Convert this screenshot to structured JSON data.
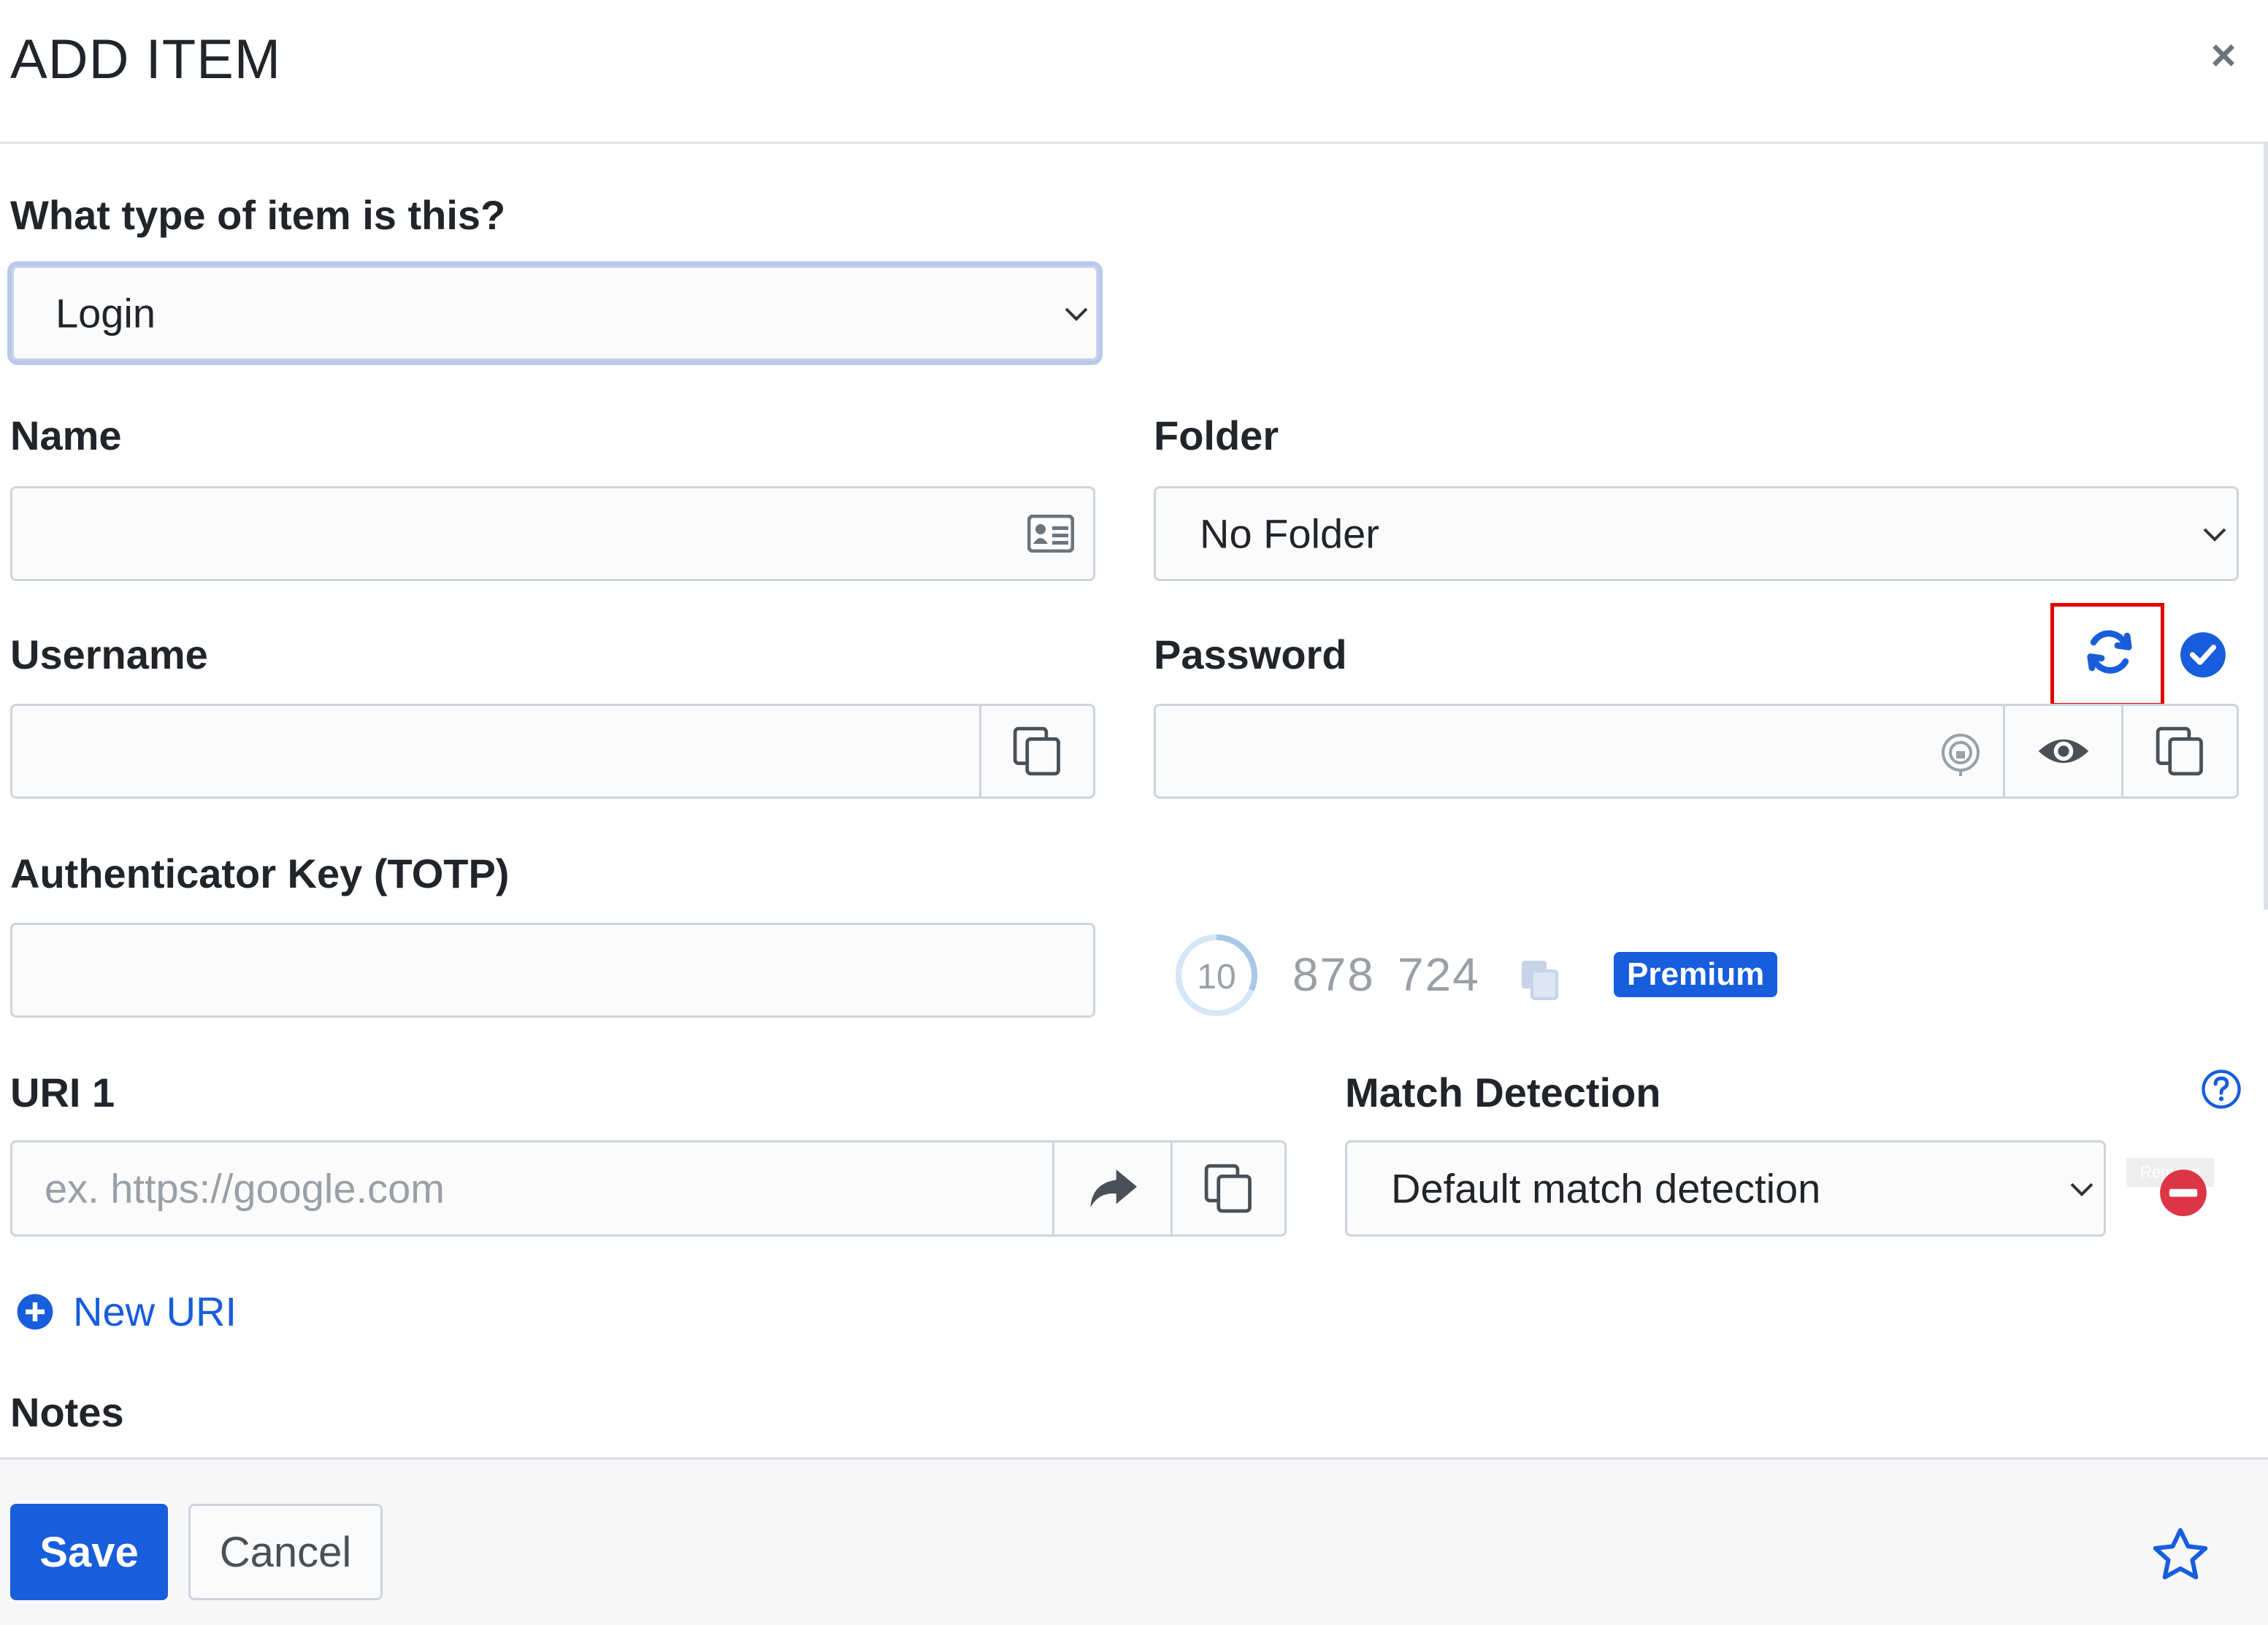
{
  "dialog": {
    "title": "ADD ITEM",
    "close_label": "×"
  },
  "type": {
    "label": "What type of item is this?",
    "value": "Login"
  },
  "name": {
    "label": "Name",
    "value": ""
  },
  "folder": {
    "label": "Folder",
    "value": "No Folder"
  },
  "username": {
    "label": "Username",
    "value": ""
  },
  "password": {
    "label": "Password",
    "value": ""
  },
  "totp": {
    "label": "Authenticator Key (TOTP)",
    "value": "",
    "countdown": "10",
    "code_part1": "878",
    "code_part2": "724",
    "badge": "Premium"
  },
  "uri": {
    "label": "URI 1",
    "placeholder": "ex. https://google.com",
    "value": ""
  },
  "match": {
    "label": "Match Detection",
    "value": "Default match detection",
    "remove_tooltip": "Remove"
  },
  "new_uri": {
    "label": "New URI"
  },
  "notes": {
    "label": "Notes"
  },
  "footer": {
    "save_label": "Save",
    "cancel_label": "Cancel"
  },
  "colors": {
    "accent": "#175ddc",
    "danger": "#dc3545",
    "highlight": "#e00000"
  }
}
